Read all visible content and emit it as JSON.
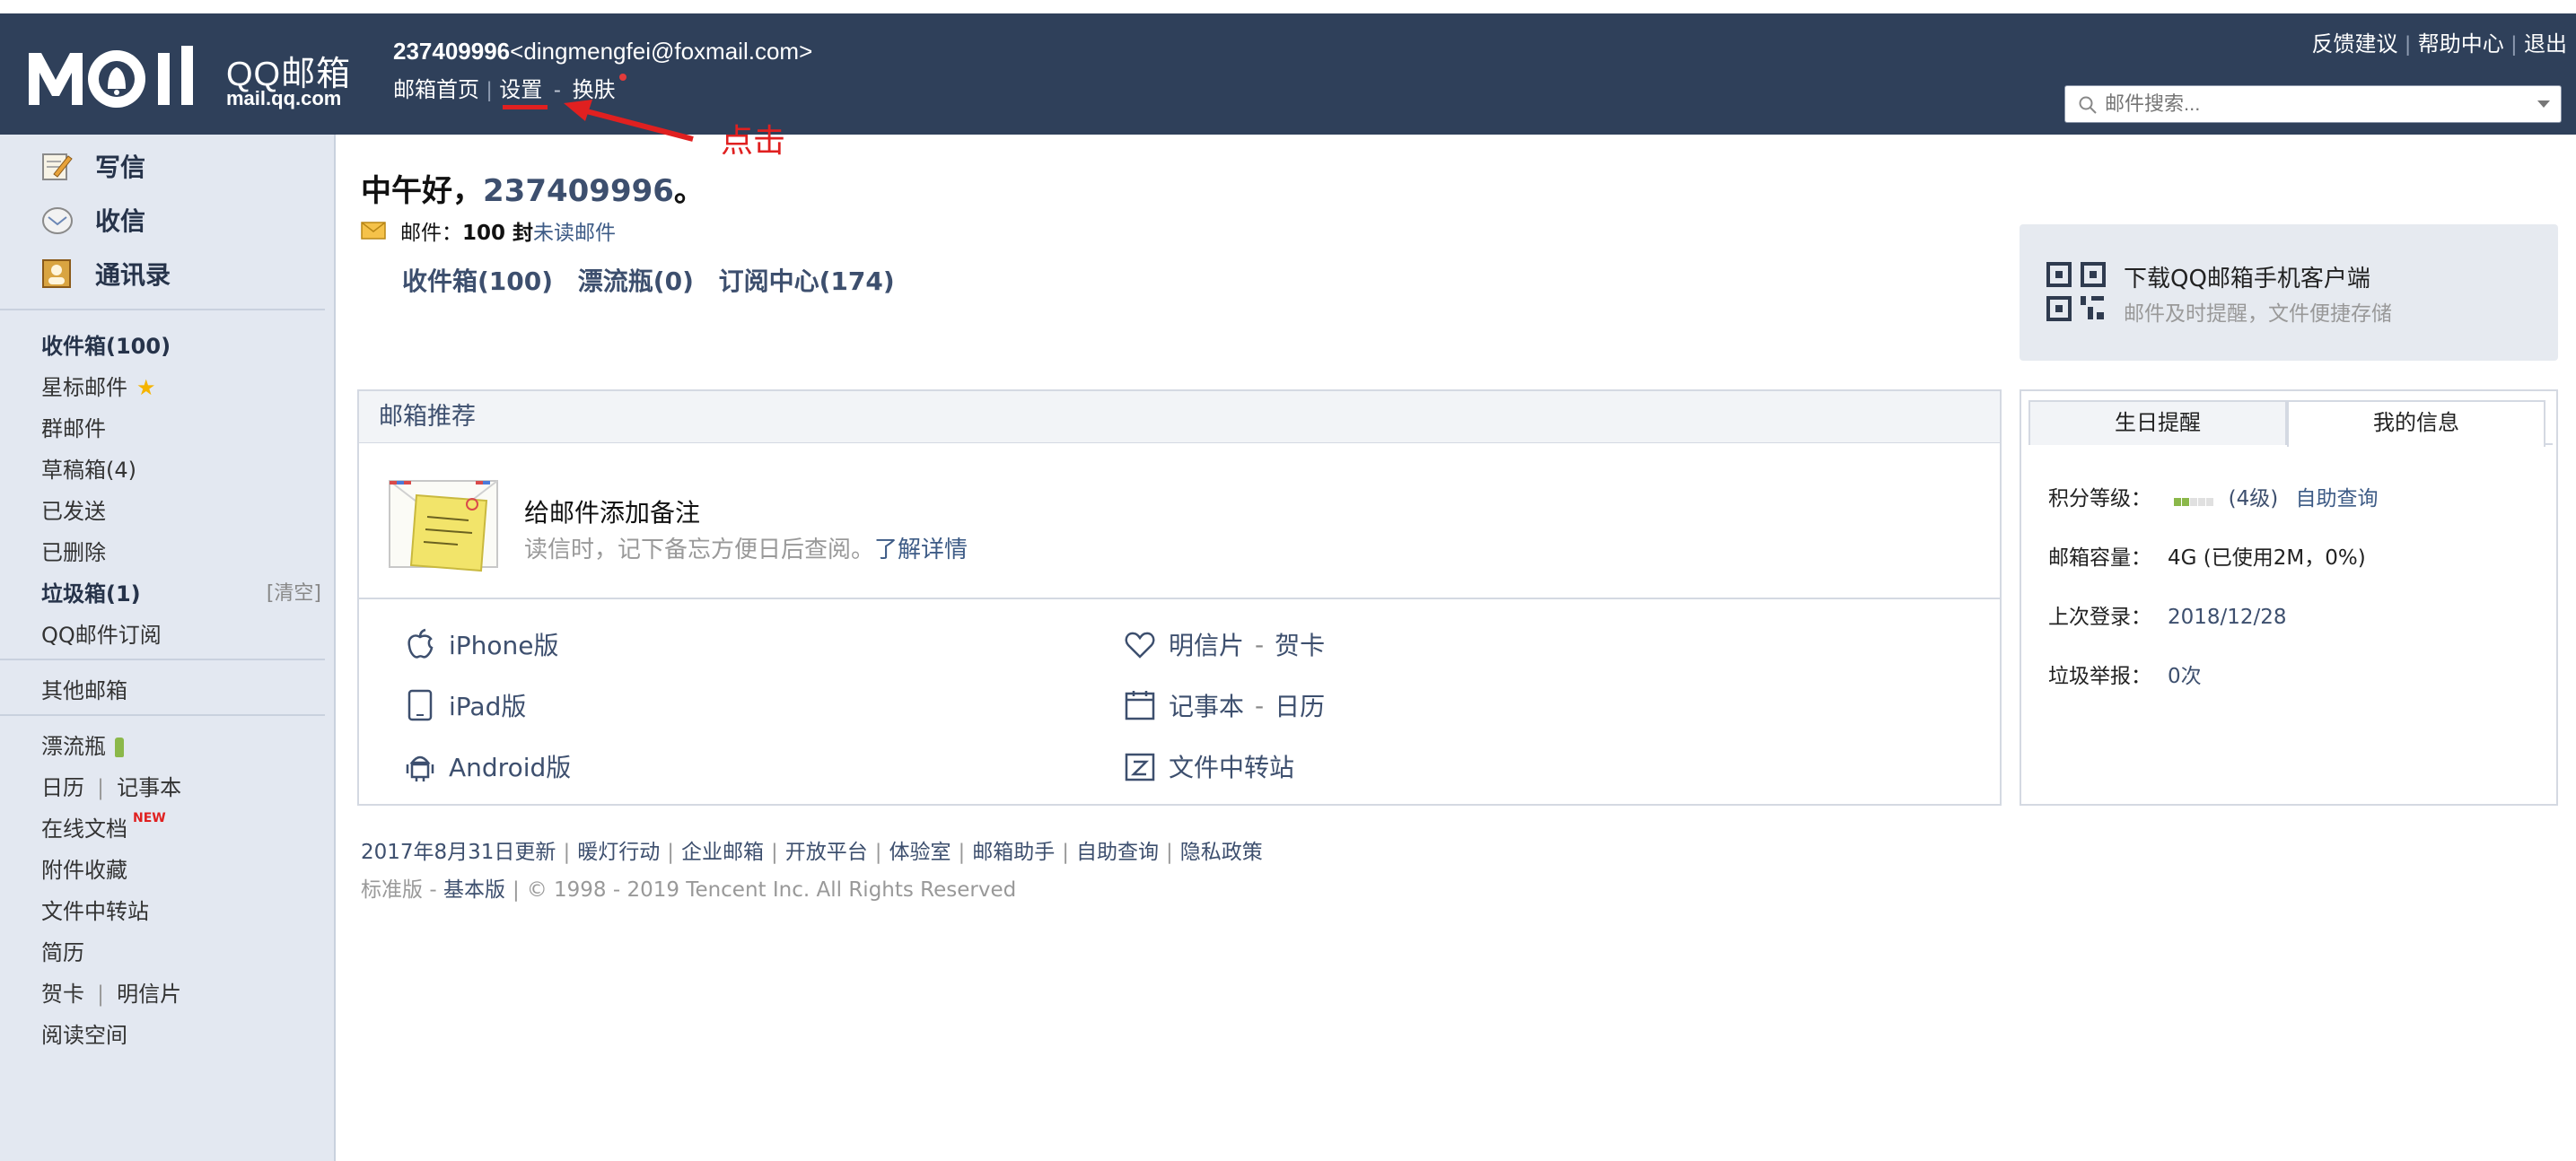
{
  "header": {
    "logo_qq": "QQ邮箱",
    "logo_url": "mail.qq.com",
    "account": "237409996",
    "email": "<dingmengfei@foxmail.com>",
    "nav": {
      "home": "邮箱首页",
      "settings": "设置",
      "dash": "-",
      "skin": "换肤"
    },
    "top_links": {
      "feedback": "反馈建议",
      "help": "帮助中心",
      "logout": "退出"
    },
    "search_placeholder": "邮件搜索..."
  },
  "annotation": {
    "text": "点击",
    "color": "#e02020"
  },
  "sidebar": {
    "actions": {
      "compose": "写信",
      "inbox": "收信",
      "contacts": "通讯录"
    },
    "folders": {
      "inbox": "收件箱(100)",
      "starred": "星标邮件",
      "group": "群邮件",
      "drafts": "草稿箱(4)",
      "sent": "已发送",
      "deleted": "已删除",
      "spam": "垃圾箱(1)",
      "spam_clear": "[清空]",
      "qq_sub": "QQ邮件订阅",
      "other": "其他邮箱",
      "bottle": "漂流瓶",
      "calendar": "日历",
      "notes": "记事本",
      "docs": "在线文档",
      "docs_badge": "NEW",
      "attach": "附件收藏",
      "transfer": "文件中转站",
      "resume": "简历",
      "card": "贺卡",
      "postcard": "明信片",
      "reading": "阅读空间"
    }
  },
  "main": {
    "greeting_prefix": "中午好，",
    "greeting_num": "237409996",
    "greeting_suffix": "。",
    "mail_label": "邮件：",
    "mail_count": "100 封",
    "mail_unread": "未读邮件",
    "folder_links": {
      "inbox": "收件箱(100)",
      "bottle": "漂流瓶(0)",
      "sub": "订阅中心(174)"
    },
    "app_card": {
      "title": "下载QQ邮箱手机客户端",
      "subtitle": "邮件及时提醒，文件便捷存储"
    },
    "rec": {
      "heading": "邮箱推荐",
      "note_title": "给邮件添加备注",
      "note_desc": "读信时，记下备忘方便日后查阅。",
      "note_more": "了解详情",
      "iphone": "iPhone版",
      "ipad": "iPad版",
      "android": "Android版",
      "postcard": "明信片",
      "greeting_card": "贺卡",
      "notes": "记事本",
      "calendar": "日历",
      "transfer": "文件中转站",
      "dash": "-"
    },
    "info": {
      "tab_birthday": "生日提醒",
      "tab_myinfo": "我的信息",
      "points_label": "积分等级：",
      "points_level": "(4级)",
      "points_level_value": 4,
      "points_query": "自助查询",
      "capacity_label": "邮箱容量：",
      "capacity_value": "4G (已使用2M，0%)",
      "last_login_label": "上次登录：",
      "last_login_value": "2018/12/28",
      "spam_label": "垃圾举报：",
      "spam_value": "0次"
    },
    "footer": {
      "update": "2017年8月31日更新",
      "warm": "暖灯行动",
      "enterprise": "企业邮箱",
      "open": "开放平台",
      "lab": "体验室",
      "assistant": "邮箱助手",
      "self_query": "自助查询",
      "privacy": "隐私政策",
      "standard": "标准版",
      "dash": "-",
      "basic": "基本版",
      "copyright": "© 1998 - 2019 Tencent Inc. All Rights Reserved"
    }
  }
}
